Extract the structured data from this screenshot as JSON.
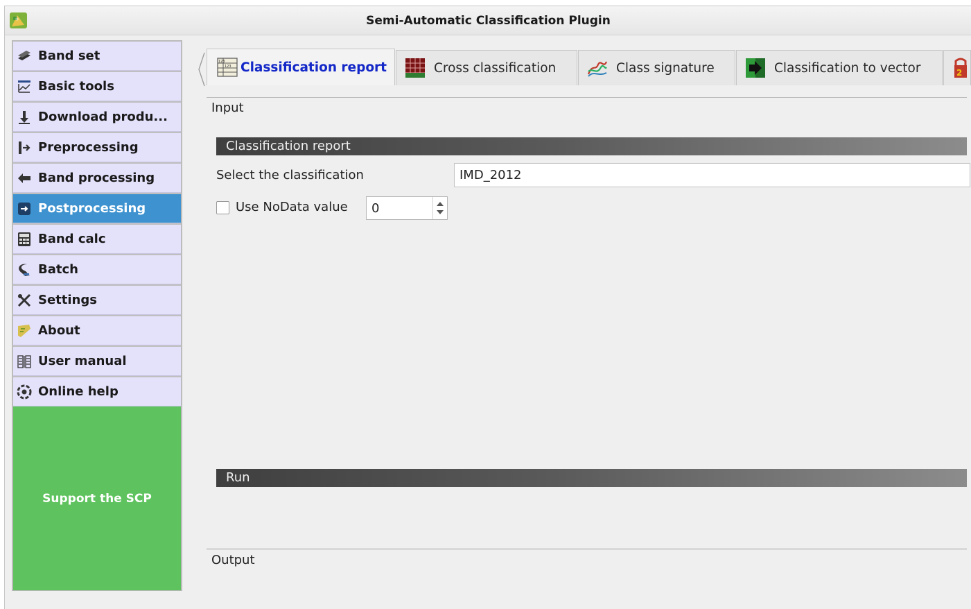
{
  "window": {
    "title": "Semi-Automatic Classification Plugin"
  },
  "sidebar": {
    "items": [
      {
        "label": "Band set",
        "icon": "band-set-icon",
        "active": false
      },
      {
        "label": "Basic tools",
        "icon": "basic-tools-icon",
        "active": false
      },
      {
        "label": "Download produ...",
        "icon": "download-icon",
        "active": false
      },
      {
        "label": "Preprocessing",
        "icon": "preprocessing-icon",
        "active": false
      },
      {
        "label": "Band processing",
        "icon": "band-processing-icon",
        "active": false
      },
      {
        "label": "Postprocessing",
        "icon": "postprocessing-icon",
        "active": true
      },
      {
        "label": "Band calc",
        "icon": "calculator-icon",
        "active": false
      },
      {
        "label": "Batch",
        "icon": "batch-icon",
        "active": false
      },
      {
        "label": "Settings",
        "icon": "settings-icon",
        "active": false
      },
      {
        "label": "About",
        "icon": "about-icon",
        "active": false
      },
      {
        "label": "User manual",
        "icon": "manual-icon",
        "active": false
      },
      {
        "label": "Online help",
        "icon": "help-icon",
        "active": false
      }
    ],
    "support_label": "Support the SCP"
  },
  "tabs": [
    {
      "label": "Classification report",
      "icon": "report-table-icon",
      "active": true
    },
    {
      "label": "Cross classification",
      "icon": "cross-classification-icon",
      "active": false
    },
    {
      "label": "Class signature",
      "icon": "class-signature-icon",
      "active": false
    },
    {
      "label": "Classification to vector",
      "icon": "classification-to-vector-icon",
      "active": false
    }
  ],
  "main": {
    "input_label": "Input",
    "section_title": "Classification report",
    "select_label": "Select the classification",
    "selected_classification": "IMD_2012",
    "nodata_label": "Use NoData value",
    "nodata_checked": false,
    "nodata_value": "0",
    "run_title": "Run",
    "output_label": "Output"
  },
  "colors": {
    "sidebar_item_bg": "#e4e1fb",
    "sidebar_active_bg": "#3d92cf",
    "support_bg": "#5ec35e",
    "active_tab_text": "#1428c8"
  }
}
